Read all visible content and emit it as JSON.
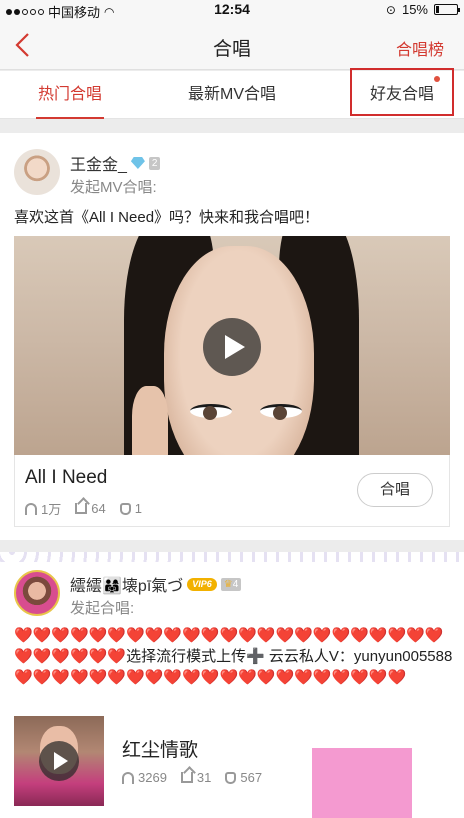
{
  "statusbar": {
    "carrier": "中国移动",
    "time": "12:54",
    "battery": "15%"
  },
  "nav": {
    "title": "合唱",
    "right_label": "合唱榜",
    "back_icon": "chevron-left-icon",
    "accent": "#d33a31"
  },
  "tabs": [
    {
      "label": "热门合唱",
      "active": true
    },
    {
      "label": "最新MV合唱",
      "active": false
    },
    {
      "label": "好友合唱",
      "active": false,
      "has_dot": true
    }
  ],
  "post1": {
    "username": "王金金_",
    "level": "2",
    "subtitle": "发起MV合唱:",
    "message": "喜欢这首《All I Need》吗？快来和我合唱吧！",
    "song_title": "All I Need",
    "listens": "1万",
    "shares": "64",
    "likes": "1",
    "join_label": "合唱"
  },
  "post2": {
    "username": "繧繧👨‍👩‍👧壊pī氣づ",
    "vip": "VIP6",
    "level": "4",
    "subtitle": "发起合唱:",
    "message_text": "选择流行模式上传➕ 云云私人V：yunyun005588",
    "song_title": "红尘情歌",
    "listens": "3269",
    "shares": "31",
    "likes": "567"
  }
}
